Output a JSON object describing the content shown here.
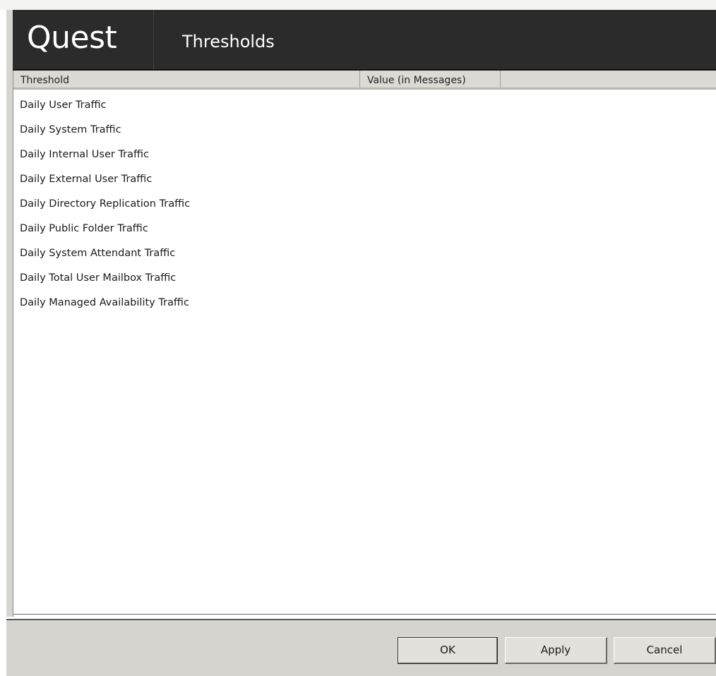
{
  "header": {
    "logo": "Quest",
    "title": "Thresholds"
  },
  "list": {
    "columns": [
      "Threshold",
      "Value (in Messages)",
      ""
    ],
    "rows": [
      "Daily User Traffic",
      "Daily System Traffic",
      "Daily Internal User Traffic",
      "Daily External User Traffic",
      "Daily Directory Replication Traffic",
      "Daily Public Folder Traffic",
      "Daily System Attendant Traffic",
      "Daily Total User Mailbox Traffic",
      "Daily Managed Availability Traffic"
    ]
  },
  "buttons": {
    "ok": "OK",
    "apply": "Apply",
    "cancel": "Cancel"
  },
  "colors": {
    "header_bg": "#2b2b2b",
    "list_bg": "#ffffff",
    "toolbar_bg": "#d6d4cf"
  }
}
